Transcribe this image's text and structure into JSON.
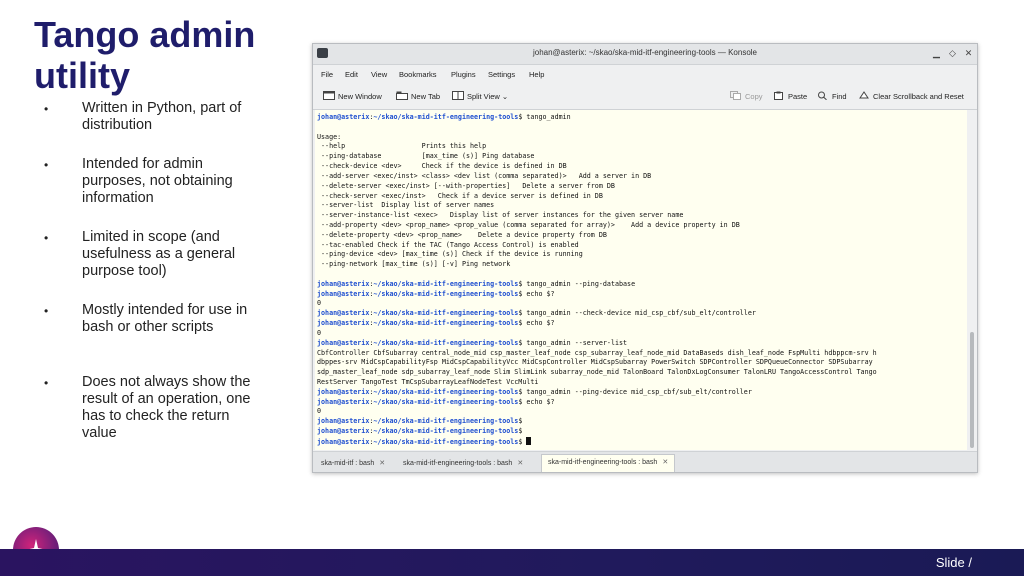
{
  "slide": {
    "title": "Tango admin utility",
    "bullets": [
      "Written in Python, part of distribution",
      "Intended for admin purposes, not obtaining information",
      "Limited in scope (and usefulness as a general purpose tool)",
      "Mostly intended for use in bash or other scripts",
      "Does not always show the result of an operation, one has to check the return value"
    ],
    "bullet_symbol": "•",
    "footer_text": "Slide  /"
  },
  "window": {
    "title": "johan@asterix: ~/skao/ska-mid-itf-engineering-tools — Konsole",
    "menu": [
      "File",
      "Edit",
      "View",
      "Bookmarks",
      "Plugins",
      "Settings",
      "Help"
    ],
    "toolbar": {
      "new_window": "New Window",
      "new_tab": "New Tab",
      "split_view": "Split View",
      "copy": "Copy",
      "paste": "Paste",
      "find": "Find",
      "clear": "Clear Scrollback and Reset"
    },
    "tabs": [
      {
        "label": "ska-mid-itf : bash",
        "active": false
      },
      {
        "label": "ska-mid-itf-engineering-tools : bash",
        "active": false
      },
      {
        "label": "ska-mid-itf-engineering-tools : bash",
        "active": true
      }
    ],
    "tab_close": "✕"
  },
  "terminal": {
    "user_host": "johan@asterix",
    "path": "~/skao/ska-mid-itf-engineering-tools",
    "lines": [
      {
        "type": "prompt",
        "cmd": "tango_admin"
      },
      {
        "type": "out",
        "text": ""
      },
      {
        "type": "out",
        "text": "Usage:"
      },
      {
        "type": "out",
        "text": " --help                   Prints this help"
      },
      {
        "type": "out",
        "text": " --ping-database          [max_time (s)] Ping database"
      },
      {
        "type": "out",
        "text": " --check-device <dev>     Check if the device is defined in DB"
      },
      {
        "type": "out",
        "text": " --add-server <exec/inst> <class> <dev list (comma separated)>   Add a server in DB"
      },
      {
        "type": "out",
        "text": " --delete-server <exec/inst> [--with-properties]   Delete a server from DB"
      },
      {
        "type": "out",
        "text": " --check-server <exec/inst>   Check if a device server is defined in DB"
      },
      {
        "type": "out",
        "text": " --server-list  Display list of server names"
      },
      {
        "type": "out",
        "text": " --server-instance-list <exec>   Display list of server instances for the given server name"
      },
      {
        "type": "out",
        "text": " --add-property <dev> <prop_name> <prop_value (comma separated for array)>    Add a device property in DB"
      },
      {
        "type": "out",
        "text": " --delete-property <dev> <prop_name>    Delete a device property from DB"
      },
      {
        "type": "out",
        "text": " --tac-enabled Check if the TAC (Tango Access Control) is enabled"
      },
      {
        "type": "out",
        "text": " --ping-device <dev> [max_time (s)] Check if the device is running"
      },
      {
        "type": "out",
        "text": " --ping-network [max_time (s)] [-v] Ping network"
      },
      {
        "type": "out",
        "text": ""
      },
      {
        "type": "prompt",
        "cmd": "tango_admin --ping-database"
      },
      {
        "type": "prompt",
        "cmd": "echo $?"
      },
      {
        "type": "out",
        "text": "0"
      },
      {
        "type": "prompt",
        "cmd": "tango_admin --check-device mid_csp_cbf/sub_elt/controller"
      },
      {
        "type": "prompt",
        "cmd": "echo $?"
      },
      {
        "type": "out",
        "text": "0"
      },
      {
        "type": "prompt",
        "cmd": "tango_admin --server-list"
      },
      {
        "type": "out",
        "text": "CbfController CbfSubarray central_node_mid csp_master_leaf_node csp_subarray_leaf_node_mid DataBaseds dish_leaf_node FspMulti hdbppcm-srv h"
      },
      {
        "type": "out",
        "text": "dbppes-srv MidCspCapabilityFsp MidCspCapabilityVcc MidCspController MidCspSubarray PowerSwitch SDPController SDPQueueConnector SDPSubarray"
      },
      {
        "type": "out",
        "text": "sdp_master_leaf_node sdp_subarray_leaf_node Slim SlimLink subarray_node_mid TalonBoard TalonDxLogConsumer TalonLRU TangoAccessControl Tango"
      },
      {
        "type": "out",
        "text": "RestServer TangoTest TmCspSubarrayLeafNodeTest VccMulti"
      },
      {
        "type": "prompt",
        "cmd": "tango_admin --ping-device mid_csp_cbf/sub_elt/controller"
      },
      {
        "type": "prompt",
        "cmd": "echo $?"
      },
      {
        "type": "out",
        "text": "0"
      },
      {
        "type": "prompt",
        "cmd": ""
      },
      {
        "type": "prompt",
        "cmd": ""
      },
      {
        "type": "prompt",
        "cmd": "",
        "cursor": true
      }
    ]
  },
  "colors": {
    "title": "#1f1d6b",
    "footer": "#201a5c",
    "prompt": "#1f4fd0",
    "terminal_bg": "#fffff0"
  },
  "icons": [
    "new-window-icon",
    "new-tab-icon",
    "split-view-icon",
    "copy-icon",
    "paste-icon",
    "find-icon",
    "clear-icon",
    "konsole-app-icon",
    "minimize-icon",
    "maximize-icon",
    "close-icon",
    "star-logo-icon"
  ]
}
